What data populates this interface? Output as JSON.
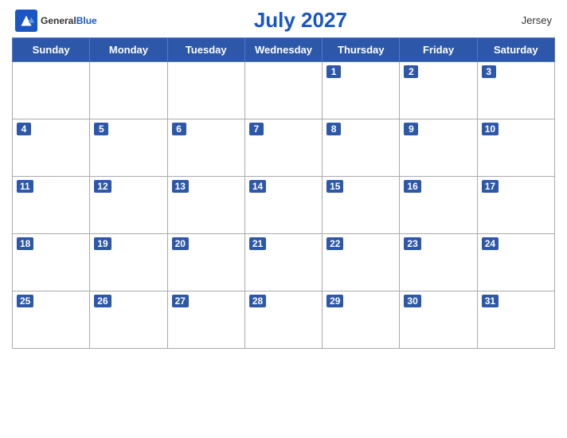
{
  "header": {
    "logo_general": "General",
    "logo_blue": "Blue",
    "title": "July 2027",
    "region": "Jersey"
  },
  "calendar": {
    "weekdays": [
      "Sunday",
      "Monday",
      "Tuesday",
      "Wednesday",
      "Thursday",
      "Friday",
      "Saturday"
    ],
    "weeks": [
      [
        null,
        null,
        null,
        null,
        1,
        2,
        3
      ],
      [
        4,
        5,
        6,
        7,
        8,
        9,
        10
      ],
      [
        11,
        12,
        13,
        14,
        15,
        16,
        17
      ],
      [
        18,
        19,
        20,
        21,
        22,
        23,
        24
      ],
      [
        25,
        26,
        27,
        28,
        29,
        30,
        31
      ]
    ]
  }
}
